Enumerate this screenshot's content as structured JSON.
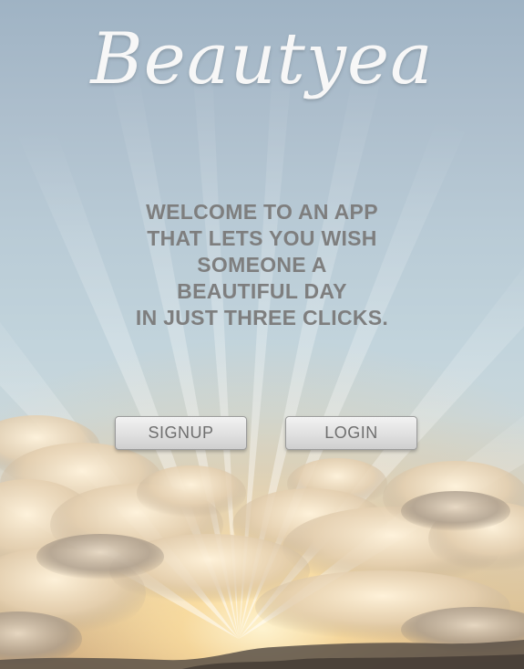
{
  "app": {
    "logo_text": "Beautyea"
  },
  "welcome": {
    "message": "WELCOME TO AN APP\nTHAT LETS YOU WISH\nSOMEONE A\nBEAUTIFUL DAY\nIN JUST THREE CLICKS."
  },
  "actions": {
    "signup_label": "SIGNUP",
    "login_label": "LOGIN"
  },
  "colors": {
    "welcome_text": "#7e7e7e",
    "button_text": "#6f6f6f",
    "logo_text": "#f7f7f7"
  }
}
